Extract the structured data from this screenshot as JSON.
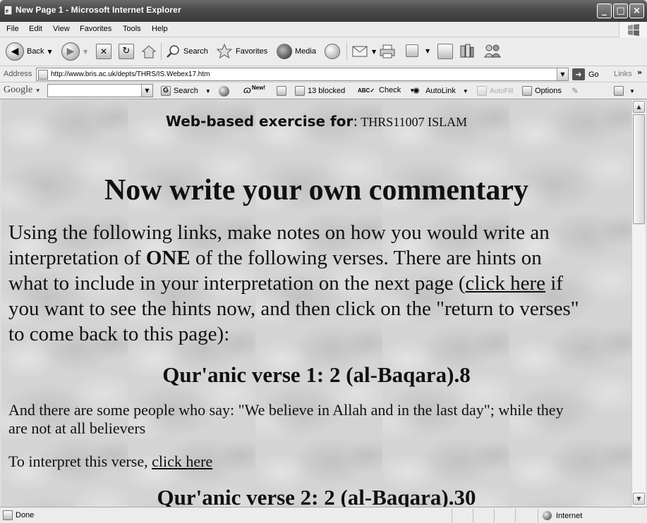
{
  "window": {
    "title": "New Page 1 - Microsoft Internet Explorer",
    "icon": "ie-page-icon",
    "controls": [
      "_",
      "□",
      "×"
    ]
  },
  "menu": [
    "File",
    "Edit",
    "View",
    "Favorites",
    "Tools",
    "Help"
  ],
  "toolbar": {
    "back": "Back",
    "search": "Search",
    "favorites": "Favorites",
    "media": "Media"
  },
  "address": {
    "label": "Address",
    "url": "http://www.bris.ac.uk/depts/THRS/IS.Webex17.htm",
    "go": "Go",
    "links": "Links"
  },
  "google": {
    "logo": "Google",
    "search": "Search",
    "new_badge": "New!",
    "blocked": "13 blocked",
    "check": "Check",
    "autolink": "AutoLink",
    "autofill": "AutoFill",
    "options": "Options"
  },
  "page": {
    "header_bold": "Web-based exercise for",
    "header_colon": ":",
    "header_course": " THRS11007 ISLAM",
    "heading": "Now write your own commentary",
    "intro": {
      "l1": "Using the following links, make notes on how you would write an",
      "l2a": "interpretation of ",
      "l2b": "ONE",
      "l2c": " of the following verses.  There are hints on",
      "l3a": "what to include in your interpretation on the next page (",
      "l3link": "click here",
      "l3b": " if",
      "l4": "you want to see the hints now, and then click on the \"return to verses\"",
      "l5": "to come back to this page):"
    },
    "verse1": {
      "title": "Qur'anic verse 1: 2 (al-Baqara).8",
      "text1": "And there are some people who say: \"We believe in Allah and in the last day\"; while they",
      "text2": "are not at all believers",
      "interpret": "To interpret this verse, ",
      "link": "click here"
    },
    "verse2": {
      "title": "Qur'anic verse 2: 2 (al-Baqara).30"
    }
  },
  "status": {
    "text": "Done",
    "zone": "Internet"
  }
}
